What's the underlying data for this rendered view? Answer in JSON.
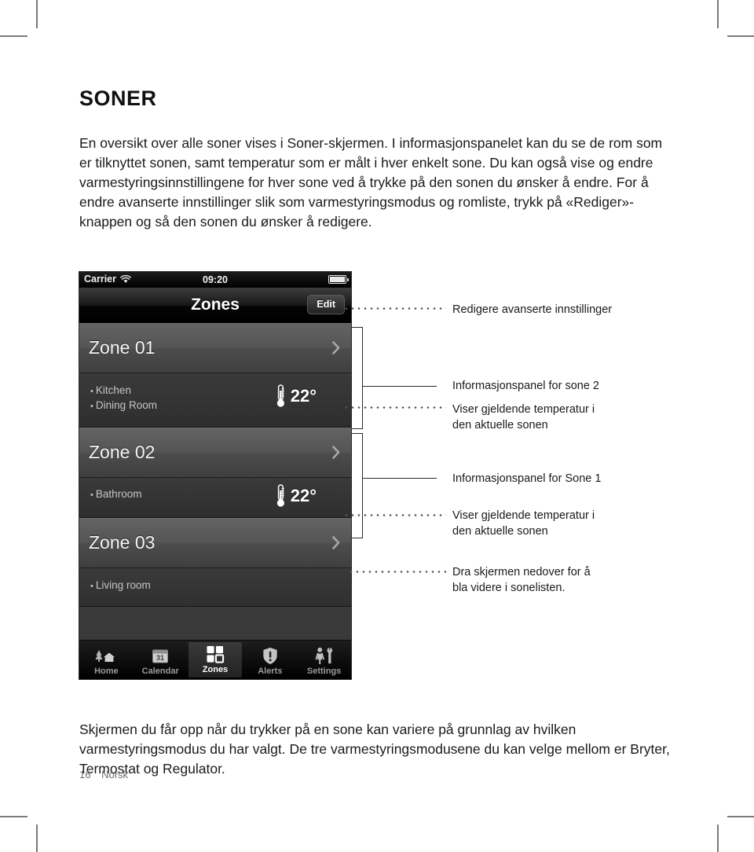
{
  "page": {
    "section_title": "SONER",
    "intro_paragraph": "En oversikt over alle soner vises i Soner-skjermen. I informasjonspanelet kan du se de rom som er tilknyttet sonen, samt temperatur som er målt i hver enkelt sone. Du kan også vise og endre varmestyringsinnstillingene for hver sone ved å trykke på den sonen du ønsker å endre. For å endre avanserte innstillinger slik som varmestyringsmodus og romliste, trykk på «Rediger»-knappen og så den sonen du ønsker å redigere.",
    "outro_paragraph": "Skjermen du får opp når du trykker på en sone kan variere på grunnlag av hvilken varmestyringsmodus du har valgt. De tre varmestyringsmodusene du kan velge mellom er Bryter, Termostat og Regulator.",
    "folio_number": "16",
    "folio_language": "Norsk"
  },
  "phone": {
    "status_bar": {
      "carrier": "Carrier",
      "wifi_icon": "wifi-icon",
      "time": "09:20",
      "battery_icon": "battery-full-icon"
    },
    "nav_bar": {
      "title": "Zones",
      "edit_label": "Edit"
    },
    "zones": [
      {
        "name": "Zone 01",
        "rooms": [
          "Kitchen",
          "Dining Room"
        ],
        "temperature": "22°",
        "thermometer_icon": "thermometer-icon",
        "chevron_icon": "chevron-right-icon"
      },
      {
        "name": "Zone 02",
        "rooms": [
          "Bathroom"
        ],
        "temperature": "22°",
        "thermometer_icon": "thermometer-icon",
        "chevron_icon": "chevron-right-icon"
      },
      {
        "name": "Zone 03",
        "rooms": [
          "Living room"
        ],
        "temperature": "",
        "thermometer_icon": "thermometer-icon",
        "chevron_icon": "chevron-right-icon"
      }
    ],
    "tab_bar": {
      "active": "Zones",
      "tabs": [
        {
          "label": "Home",
          "icon": "house-tree-icon"
        },
        {
          "label": "Calendar",
          "icon": "calendar-icon"
        },
        {
          "label": "Zones",
          "icon": "grid-squares-icon"
        },
        {
          "label": "Alerts",
          "icon": "shield-alert-icon"
        },
        {
          "label": "Settings",
          "icon": "person-wrench-icon"
        }
      ]
    }
  },
  "annotations": [
    {
      "text": "Redigere avanserte innstillinger"
    },
    {
      "text": "Informasjonspanel for sone 2"
    },
    {
      "text": "Viser gjeldende temperatur i\nden aktuelle sonen"
    },
    {
      "text": "Informasjonspanel for Sone 1"
    },
    {
      "text": "Viser gjeldende temperatur i\nden aktuelle sonen"
    },
    {
      "text": "Dra skjermen nedover for å\nbla videre i sonelisten."
    }
  ],
  "colors": {
    "page_background": "#ffffff",
    "text": "#1a1a1a",
    "crop_mark": "#7a7a7a",
    "phone_chrome": "#000000",
    "phone_row": "#555555",
    "phone_panel": "#343434",
    "leader_line": "#2b2b2b"
  }
}
